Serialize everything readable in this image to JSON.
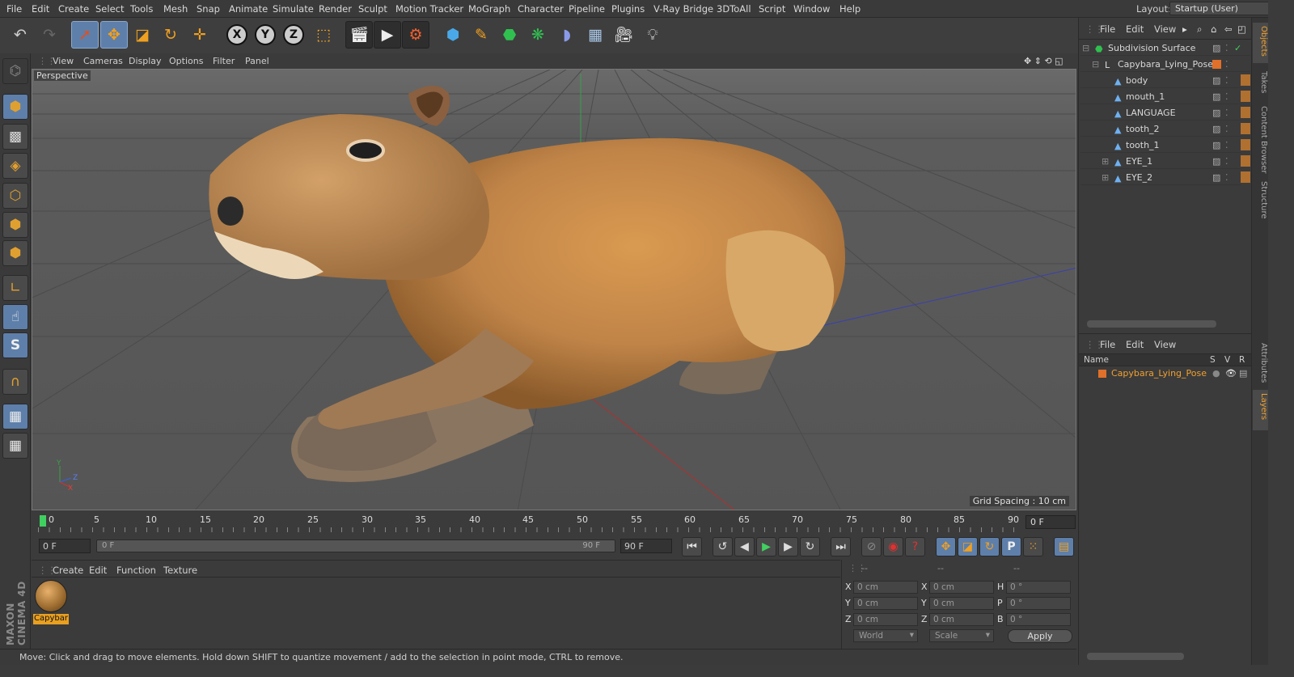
{
  "menu": [
    "File",
    "Edit",
    "Create",
    "Select",
    "Tools",
    "Mesh",
    "Snap",
    "Animate",
    "Simulate",
    "Render",
    "Sculpt",
    "Motion Tracker",
    "MoGraph",
    "Character",
    "Pipeline",
    "Plugins",
    "V-Ray Bridge",
    "3DToAll",
    "Script",
    "Window",
    "Help"
  ],
  "layout": {
    "label": "Layout:",
    "value": "Startup (User)"
  },
  "toolbar": {
    "x_label": "X",
    "y_label": "Y",
    "z_label": "Z"
  },
  "viewport": {
    "menu": [
      "View",
      "Cameras",
      "Display",
      "Options",
      "Filter",
      "Panel"
    ],
    "camera_label": "Perspective",
    "grid_spacing": "Grid Spacing : 10 cm",
    "axis_y": "Y",
    "axis_z": "Z",
    "axis_x": "X"
  },
  "timeline": {
    "ticks": [
      "0",
      "5",
      "10",
      "15",
      "20",
      "25",
      "30",
      "35",
      "40",
      "45",
      "50",
      "55",
      "60",
      "65",
      "70",
      "75",
      "80",
      "85",
      "90"
    ],
    "current_frame": "0 F"
  },
  "transport": {
    "start_field": "0 F",
    "slider_left": "0 F",
    "slider_right": "90 F",
    "end_field": "90 F"
  },
  "materials": {
    "menu": [
      "Create",
      "Edit",
      "Function",
      "Texture"
    ],
    "items": [
      {
        "label": "Capybar"
      }
    ]
  },
  "coords": {
    "header1": "--",
    "header2": "--",
    "header3": "--",
    "rows": [
      {
        "l1": "X",
        "v1": "0 cm",
        "l2": "X",
        "v2": "0 cm",
        "l3": "H",
        "v3": "0 °"
      },
      {
        "l1": "Y",
        "v1": "0 cm",
        "l2": "Y",
        "v2": "0 cm",
        "l3": "P",
        "v3": "0 °"
      },
      {
        "l1": "Z",
        "v1": "0 cm",
        "l2": "Z",
        "v2": "0 cm",
        "l3": "B",
        "v3": "0 °"
      }
    ],
    "space": "World",
    "mode": "Scale",
    "apply": "Apply"
  },
  "status": "Move: Click and drag to move elements. Hold down SHIFT to quantize movement / add to the selection in point mode, CTRL to remove.",
  "brand": "MAXON CINEMA 4D",
  "objects": {
    "menu": [
      "File",
      "Edit",
      "View"
    ],
    "items": [
      {
        "name": "Subdivision Surface"
      },
      {
        "name": "Capybara_Lying_Pose"
      },
      {
        "name": "body"
      },
      {
        "name": "mouth_1"
      },
      {
        "name": "LANGUAGE"
      },
      {
        "name": "tooth_2"
      },
      {
        "name": "tooth_1"
      },
      {
        "name": "EYE_1"
      },
      {
        "name": "EYE_2"
      }
    ]
  },
  "layers": {
    "menu": [
      "File",
      "Edit",
      "View"
    ],
    "col_name": "Name",
    "col_s": "S",
    "col_v": "V",
    "col_r": "R",
    "items": [
      {
        "name": "Capybara_Lying_Pose",
        "color": "#e0702a"
      }
    ]
  },
  "side_tabs": [
    "Objects",
    "Takes",
    "Content Browser",
    "Structure",
    "Attributes",
    "Layers"
  ],
  "colors": {
    "accent": "#5e7faa",
    "layer_orange": "#e0702a",
    "material_highlight": "#e8a020"
  }
}
